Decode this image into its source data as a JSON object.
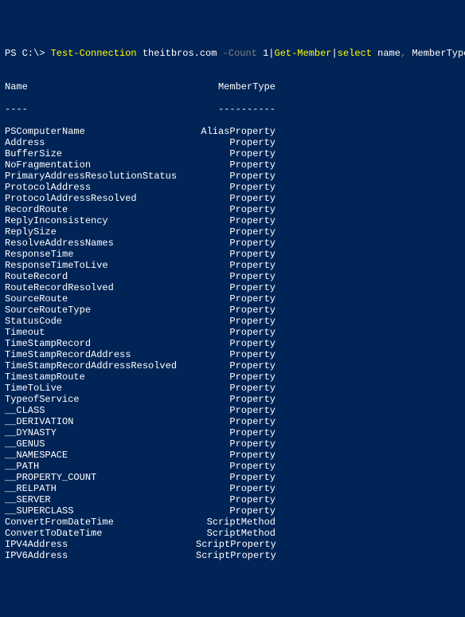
{
  "prompt": {
    "prefix": "PS C:\\> ",
    "cmdlet1": "Test-Connection",
    "arg1": " theitbros.com ",
    "param1": "-Count ",
    "num1": "1",
    "pipe1": "|",
    "cmdlet2": "Get-Member",
    "pipe2": "|",
    "cmdlet3": "select",
    "arg2": " name",
    "comma": ",",
    "arg3": " MemberType"
  },
  "headers": {
    "name": "Name",
    "type": "MemberType"
  },
  "dividers": {
    "name": "----",
    "type": "----------"
  },
  "rows": [
    {
      "name": "PSComputerName",
      "type": "AliasProperty"
    },
    {
      "name": "Address",
      "type": "Property"
    },
    {
      "name": "BufferSize",
      "type": "Property"
    },
    {
      "name": "NoFragmentation",
      "type": "Property"
    },
    {
      "name": "PrimaryAddressResolutionStatus",
      "type": "Property"
    },
    {
      "name": "ProtocolAddress",
      "type": "Property"
    },
    {
      "name": "ProtocolAddressResolved",
      "type": "Property"
    },
    {
      "name": "RecordRoute",
      "type": "Property"
    },
    {
      "name": "ReplyInconsistency",
      "type": "Property"
    },
    {
      "name": "ReplySize",
      "type": "Property"
    },
    {
      "name": "ResolveAddressNames",
      "type": "Property"
    },
    {
      "name": "ResponseTime",
      "type": "Property"
    },
    {
      "name": "ResponseTimeToLive",
      "type": "Property"
    },
    {
      "name": "RouteRecord",
      "type": "Property"
    },
    {
      "name": "RouteRecordResolved",
      "type": "Property"
    },
    {
      "name": "SourceRoute",
      "type": "Property"
    },
    {
      "name": "SourceRouteType",
      "type": "Property"
    },
    {
      "name": "StatusCode",
      "type": "Property"
    },
    {
      "name": "Timeout",
      "type": "Property"
    },
    {
      "name": "TimeStampRecord",
      "type": "Property"
    },
    {
      "name": "TimeStampRecordAddress",
      "type": "Property"
    },
    {
      "name": "TimeStampRecordAddressResolved",
      "type": "Property"
    },
    {
      "name": "TimestampRoute",
      "type": "Property"
    },
    {
      "name": "TimeToLive",
      "type": "Property"
    },
    {
      "name": "TypeofService",
      "type": "Property"
    },
    {
      "name": "__CLASS",
      "type": "Property"
    },
    {
      "name": "__DERIVATION",
      "type": "Property"
    },
    {
      "name": "__DYNASTY",
      "type": "Property"
    },
    {
      "name": "__GENUS",
      "type": "Property"
    },
    {
      "name": "__NAMESPACE",
      "type": "Property"
    },
    {
      "name": "__PATH",
      "type": "Property"
    },
    {
      "name": "__PROPERTY_COUNT",
      "type": "Property"
    },
    {
      "name": "__RELPATH",
      "type": "Property"
    },
    {
      "name": "__SERVER",
      "type": "Property"
    },
    {
      "name": "__SUPERCLASS",
      "type": "Property"
    },
    {
      "name": "ConvertFromDateTime",
      "type": "ScriptMethod"
    },
    {
      "name": "ConvertToDateTime",
      "type": "ScriptMethod"
    },
    {
      "name": "IPV4Address",
      "type": "ScriptProperty"
    },
    {
      "name": "IPV6Address",
      "type": "ScriptProperty"
    }
  ]
}
